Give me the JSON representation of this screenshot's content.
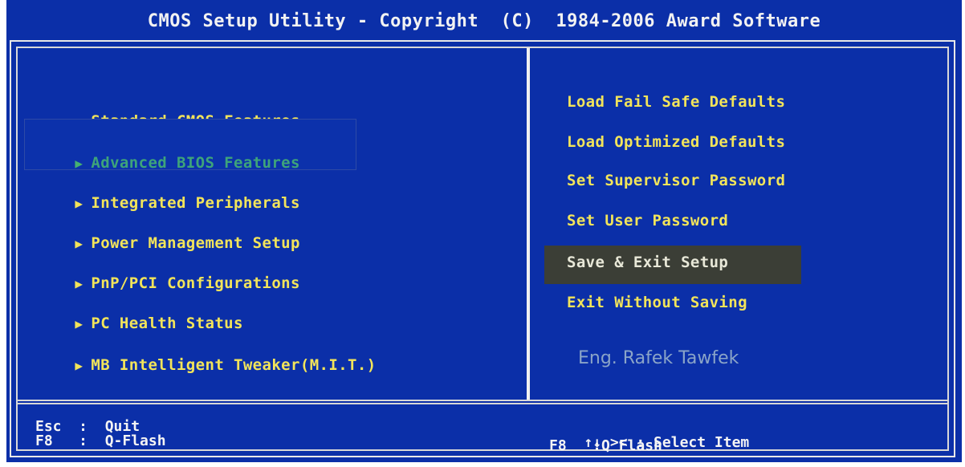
{
  "title": "CMOS Setup Utility - Copyright  (C)  1984-2006 Award Software",
  "left_menu": [
    {
      "label": "Standard CMOS Features"
    },
    {
      "label": "Advanced BIOS Features"
    },
    {
      "label": "Integrated Peripherals"
    },
    {
      "label": "Power Management Setup"
    },
    {
      "label": "PnP/PCI Configurations"
    },
    {
      "label": "PC Health Status"
    },
    {
      "label": "MB Intelligent Tweaker(M.I.T.)"
    }
  ],
  "right_menu": [
    {
      "label": "Load Fail Safe Defaults"
    },
    {
      "label": "Load Optimized Defaults"
    },
    {
      "label": "Set Supervisor Password"
    },
    {
      "label": "Set User Password"
    },
    {
      "label": "Save & Exit Setup"
    },
    {
      "label": "Exit Without Saving"
    }
  ],
  "watermark": "Eng. Rafek Tawfek",
  "footer": {
    "left_line1": "Esc  :  Quit",
    "left_line2": "F8   :  Q-Flash",
    "right_line1_arrows": "↑↓ ><",
    "right_line1_text": " : Select Item",
    "right_line2": "F8   :Q Flash"
  },
  "colors": {
    "background": "#0b2fa8",
    "menu_text": "#f2e45a",
    "selected_text": "#3ea47a",
    "highlight_bar": "#3b3e36"
  }
}
